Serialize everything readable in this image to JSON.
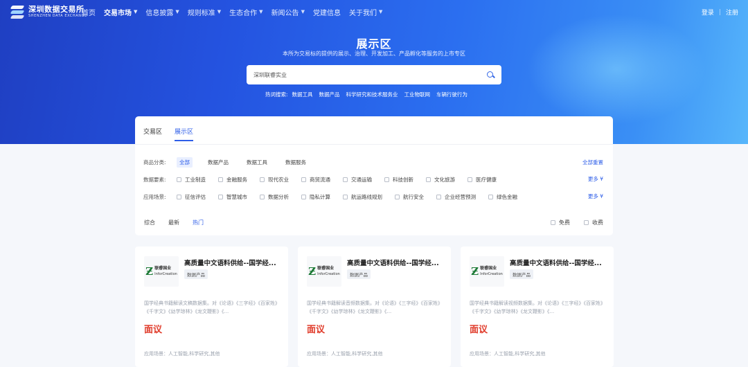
{
  "header": {
    "logo_cn": "深圳数据交易所",
    "logo_en": "SHENZHEN DATA EXCHANGE",
    "menu": [
      {
        "label": "首页",
        "has_dropdown": false,
        "active": false
      },
      {
        "label": "交易市场",
        "has_dropdown": true,
        "active": true
      },
      {
        "label": "信息披露",
        "has_dropdown": true,
        "active": false
      },
      {
        "label": "规则标准",
        "has_dropdown": true,
        "active": false
      },
      {
        "label": "生态合作",
        "has_dropdown": true,
        "active": false
      },
      {
        "label": "新闻公告",
        "has_dropdown": true,
        "active": false
      },
      {
        "label": "党建信息",
        "has_dropdown": false,
        "active": false
      },
      {
        "label": "关于我们",
        "has_dropdown": true,
        "active": false
      }
    ],
    "login": "登录",
    "register": "注册"
  },
  "hero": {
    "title": "展示区",
    "subtitle": "本所为交易标的提供的展示、治理、开发加工、产品孵化等服务的上市专区",
    "search_value": "深圳联睿实业",
    "hot_label": "热词搜索:",
    "hot_terms": [
      "数据工具",
      "数据产品",
      "科学研究和技术服务业",
      "工业物联网",
      "车辆行驶行为"
    ]
  },
  "panel": {
    "tabs": [
      {
        "label": "交易区",
        "active": false
      },
      {
        "label": "展示区",
        "active": true
      }
    ],
    "category": {
      "label": "商品分类:",
      "items": [
        {
          "label": "全部",
          "active": true
        },
        {
          "label": "数据产品",
          "active": false
        },
        {
          "label": "数据工具",
          "active": false
        },
        {
          "label": "数据服务",
          "active": false
        }
      ],
      "reset": "全部重置"
    },
    "elements": {
      "label": "数据要素:",
      "items": [
        "工业制造",
        "金融服务",
        "现代农业",
        "商贸流通",
        "交通运输",
        "科技创新",
        "文化旅游",
        "医疗健康"
      ],
      "more": "更多"
    },
    "scenes": {
      "label": "应用场景:",
      "items": [
        "征信评估",
        "智慧城市",
        "数据分析",
        "隐私计算",
        "航运路线规划",
        "航行安全",
        "企业经营预测",
        "绿色金融"
      ],
      "more": "更多"
    }
  },
  "sort": {
    "items": [
      {
        "label": "综合",
        "active": false
      },
      {
        "label": "最新",
        "active": false
      },
      {
        "label": "热门",
        "active": true
      }
    ],
    "price_options": [
      "免费",
      "收费"
    ]
  },
  "cards": [
    {
      "logo_cn": "联睿国业",
      "logo_en": "InforCreation",
      "title": "高质量中文语料供给--国学经...",
      "tag": "数据产品",
      "desc": "国学经典书籍解读文稿数据集。对《论语》《三字经》《百家姓》《千字文》《幼学琼林》《龙文鞭影》《...",
      "price": "面议",
      "scene": "应用场景：人工智能,科学研究,其他"
    },
    {
      "logo_cn": "联睿国业",
      "logo_en": "InforCreation",
      "title": "高质量中文语料供给--国学经...",
      "tag": "数据产品",
      "desc": "国学经典书籍解读音频数据集。对《论语》《三字经》《百家姓》《千字文》《幼学琼林》《龙文鞭影》《...",
      "price": "面议",
      "scene": "应用场景：人工智能,科学研究,其他"
    },
    {
      "logo_cn": "联睿国业",
      "logo_en": "InforCreation",
      "title": "高质量中文语料供给--国学经...",
      "tag": "数据产品",
      "desc": "国学经典书籍解读视频数据集。对《论语》《三字经》《百家姓》《千字文》《幼学琼林》《龙文鞭影》《...",
      "price": "面议",
      "scene": "应用场景：人工智能,科学研究,其他"
    }
  ],
  "colors": {
    "accent": "#2e5ee8",
    "price": "#e03b2a",
    "hero_start": "#1f3fc2",
    "hero_end": "#57b6fb"
  },
  "icons": {
    "logo": "data-exchange-logo-icon",
    "search": "search-icon",
    "dropdown": "chevron-down-icon",
    "more": "double-chevron-down-icon"
  }
}
